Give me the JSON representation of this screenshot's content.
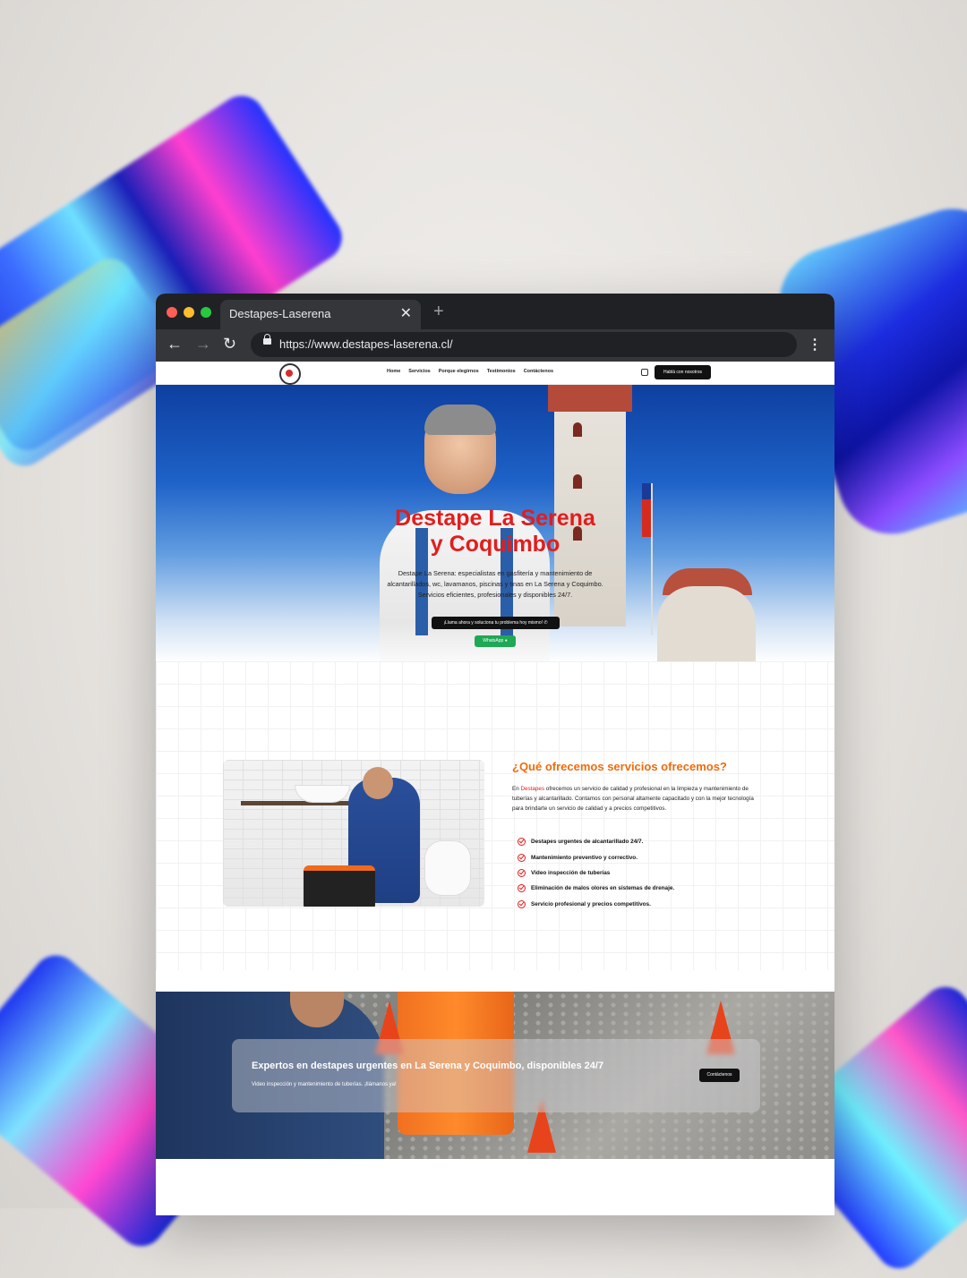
{
  "browser": {
    "tab_title": "Destapes-Laserena",
    "url": "https://www.destapes-laserena.cl/",
    "traffic_lights": [
      "#ff5f57",
      "#febc2e",
      "#28c840"
    ]
  },
  "site": {
    "nav": {
      "items": [
        "Home",
        "Servicios",
        "Porque elegirnos",
        "Testimonios",
        "Contáctenos"
      ],
      "button_label": "Hablá con nosotros"
    },
    "hero": {
      "title_line1": "Destape La Serena",
      "title_line2": "y Coquimbo",
      "description": "Destape La Serena: especialistas en gasfitería y mantenimiento de alcantarillados, wc, lavamanos, piscinas y tinas en La Serena y Coquimbo. Servicios eficientes, profesionales y disponibles 24/7.",
      "cta_label": "¡Llama ahora y soluciona tu problema hoy mismo!",
      "whatsapp_label": "WhatsApp"
    },
    "services": {
      "title": "¿Qué ofrecemos servicios ofrecemos?",
      "desc_prefix": "En ",
      "desc_highlight": "Destapes",
      "desc_rest": " ofrecemos un servicio de calidad y profesional en la limpieza y mantenimiento de tuberías y alcantarillado. Contamos con personal altamente capacitado y con la mejor tecnología para brindarte un servicio de calidad y a precios competitivos.",
      "items": [
        "Destapes urgentes de alcantarillado 24/7.",
        "Mantenimiento preventivo y correctivo.",
        "Video inspección de tuberías",
        "Eliminación de malos olores en sistemas de drenaje.",
        "Servicio profesional y precios competitivos."
      ]
    },
    "cta_banner": {
      "title": "Expertos en destapes urgentes en La Serena y Coquimbo, disponibles 24/7",
      "subtitle": "Video inspección y mantenimiento de tuberías. ¡llámanos ya!",
      "button_label": "Contáctenos"
    },
    "colors": {
      "accent_red": "#e21d1d",
      "accent_orange": "#ef6b0c",
      "whatsapp_green": "#1fa855"
    }
  }
}
